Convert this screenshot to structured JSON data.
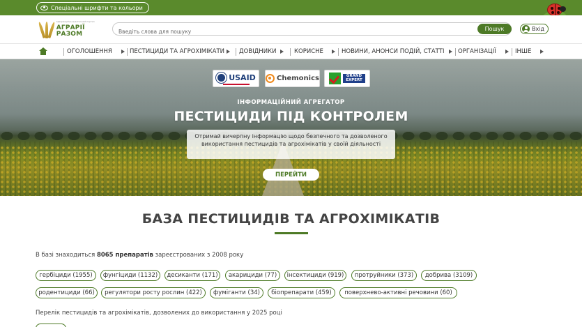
{
  "topbar": {
    "accessibility_label": "Спеціальні шрифти та кольори"
  },
  "header": {
    "logo_small": "Інформаційно-аналітичний портал",
    "logo_name": "АГРАРІЇ РАЗОМ",
    "search_placeholder": "Введіть слова для пошуку",
    "search_button": "Пошук",
    "login_label": "Вхід"
  },
  "nav": {
    "items": [
      "ОГОЛОШЕННЯ",
      "ПЕСТИЦИДИ ТА АГРОХІМІКАТИ",
      "ДОВІДНИКИ",
      "КОРИСНЕ",
      "НОВИНИ, АНОНСИ ПОДІЙ, СТАТТІ",
      "ОРГАНІЗАЦІЇ",
      "ІНШЕ"
    ]
  },
  "hero": {
    "partners": {
      "usaid": "USAID",
      "chemonics": "Chemonics",
      "grand_expert": "GRAND EXPERT"
    },
    "subtitle": "ІНФОРМАЦІЙНИЙ АГРЕГАТОР",
    "title": "ПЕСТИЦИДИ ПІД КОНТРОЛЕМ",
    "description": "Отримай вичерпну інформацію щодо безпечного та дозволеного використання пестицидів та агрохімікатів у своїй діяльності",
    "button": "ПЕРЕЙТИ"
  },
  "main": {
    "section_title": "БАЗА ПЕСТИЦИДІВ ТА АГРОХІМІКАТІВ",
    "stat_prefix": "В базі знаходиться ",
    "stat_bold": "8065 препаратів",
    "stat_suffix": " зареєстрованих з 2008 року",
    "categories": [
      "гербіциди (1955)",
      "фунгіциди (1132)",
      "десиканти (171)",
      "акарициди (77)",
      "інсектициди (919)",
      "протруйники (373)",
      "добрива (3109)",
      "родентициди (66)",
      "регулятори росту рослин (422)",
      "фуміганти (34)",
      "біопрепарати (459)",
      "поверхнево-активні речовини (60)"
    ],
    "list_caption": "Перелік пестицидів та агрохімікатів, дозволених до використання у 2025 році"
  },
  "colors": {
    "brand_green": "#4d7a26",
    "topbar_green": "#5a8a2c"
  }
}
